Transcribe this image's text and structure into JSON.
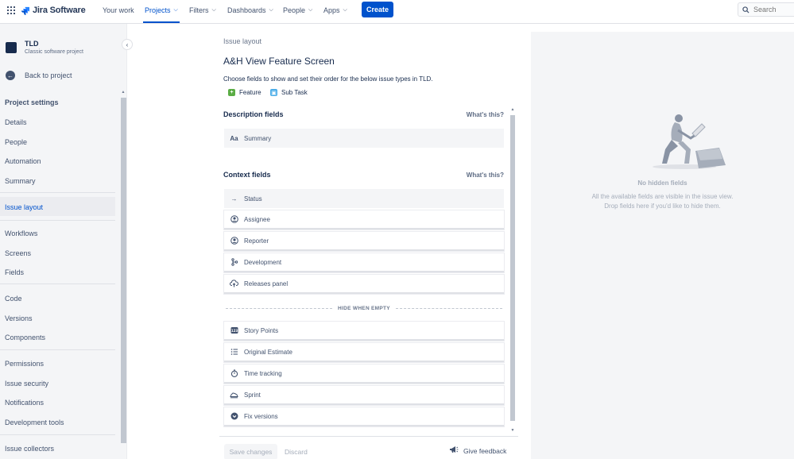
{
  "topnav": {
    "product_name": "Jira Software",
    "items": [
      {
        "label": "Your work",
        "has_dropdown": false
      },
      {
        "label": "Projects",
        "has_dropdown": true,
        "active": true
      },
      {
        "label": "Filters",
        "has_dropdown": true
      },
      {
        "label": "Dashboards",
        "has_dropdown": true
      },
      {
        "label": "People",
        "has_dropdown": true
      },
      {
        "label": "Apps",
        "has_dropdown": true
      }
    ],
    "create_label": "Create",
    "search_placeholder": "Search",
    "accent_color": "#0052cc"
  },
  "sidebar": {
    "project_name": "TLD",
    "project_type": "Classic software project",
    "back_label": "Back to project",
    "heading": "Project settings",
    "items": [
      {
        "label": "Details"
      },
      {
        "label": "People"
      },
      {
        "label": "Automation"
      },
      {
        "label": "Summary"
      },
      {
        "label": "Issue layout",
        "active": true
      },
      {
        "label": "Workflows"
      },
      {
        "label": "Screens"
      },
      {
        "label": "Fields"
      },
      {
        "label": "Code"
      },
      {
        "label": "Versions"
      },
      {
        "label": "Components"
      },
      {
        "label": "Permissions"
      },
      {
        "label": "Issue security"
      },
      {
        "label": "Notifications"
      },
      {
        "label": "Development tools"
      },
      {
        "label": "Issue collectors"
      }
    ]
  },
  "main": {
    "breadcrumb": "Issue layout",
    "title": "A&H View Feature Screen",
    "description": "Choose fields to show and set their order for the below issue types in TLD.",
    "issue_types": [
      {
        "label": "Feature",
        "icon": "plus-square-icon",
        "color": "#5aac44"
      },
      {
        "label": "Sub Task",
        "icon": "subtask-icon",
        "color": "#4bade8"
      }
    ],
    "description_section": {
      "title": "Description fields",
      "help": "What's this?",
      "fields": [
        {
          "label": "Summary",
          "icon": "text-icon"
        }
      ]
    },
    "context_section": {
      "title": "Context fields",
      "help": "What's this?",
      "fields": [
        {
          "label": "Status",
          "icon": "arrow-right-icon"
        },
        {
          "label": "Assignee",
          "icon": "user-icon"
        },
        {
          "label": "Reporter",
          "icon": "user-icon"
        },
        {
          "label": "Development",
          "icon": "branch-icon"
        },
        {
          "label": "Releases panel",
          "icon": "cloud-icon"
        }
      ],
      "hide_when_empty_label": "HIDE WHEN EMPTY",
      "hidden_fields": [
        {
          "label": "Story Points",
          "icon": "number-icon"
        },
        {
          "label": "Original Estimate",
          "icon": "list-icon"
        },
        {
          "label": "Time tracking",
          "icon": "stopwatch-icon"
        },
        {
          "label": "Sprint",
          "icon": "sprint-icon"
        },
        {
          "label": "Fix versions",
          "icon": "version-icon"
        }
      ]
    },
    "footer": {
      "save_label": "Save changes",
      "discard_label": "Discard",
      "feedback_label": "Give feedback"
    }
  },
  "right_panel": {
    "empty_title": "No hidden fields",
    "empty_line1": "All the available fields are visible in the issue view.",
    "empty_line2": "Drop fields here if you'd like to hide them."
  }
}
